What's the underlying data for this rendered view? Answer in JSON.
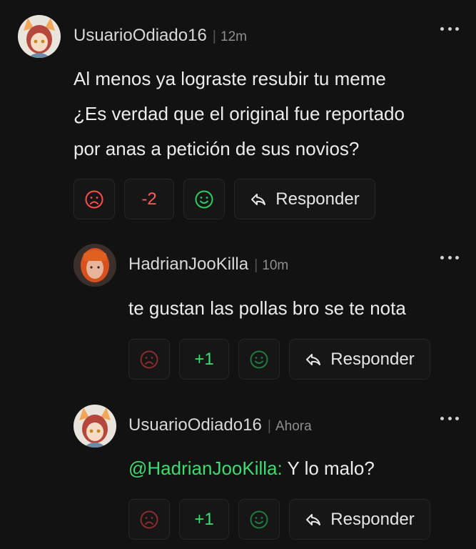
{
  "comments": [
    {
      "username": "UsuarioOdiado16",
      "time": "12m",
      "text": "Al menos ya lograste resubir tu meme\n¿Es verdad que el original fue reportado\npor anas a petición de sus novios?",
      "score": "-2",
      "score_color": "#ff5c5c",
      "reply_label": "Responder"
    },
    {
      "username": "HadrianJooKilla",
      "time": "10m",
      "text": "te gustan las pollas bro se te nota",
      "score": "+1",
      "score_color": "#3ddc6e",
      "reply_label": "Responder"
    },
    {
      "username": "UsuarioOdiado16",
      "time": "Ahora",
      "mention": "@HadrianJooKilla:",
      "text": " Y lo malo?",
      "score": "+1",
      "score_color": "#3ddc6e",
      "reply_label": "Responder"
    }
  ],
  "icons": {
    "downvote": "sad-face-icon",
    "upvote": "happy-face-icon",
    "reply": "reply-arrow-icon",
    "more": "more-options-icon"
  },
  "colors": {
    "downvote_active": "#ff4d4d",
    "downvote_muted": "#8a2c2c",
    "upvote_active": "#2ecc5f",
    "upvote_muted": "#1f7a3f",
    "mention": "#3ddc6e",
    "background": "#121212"
  }
}
